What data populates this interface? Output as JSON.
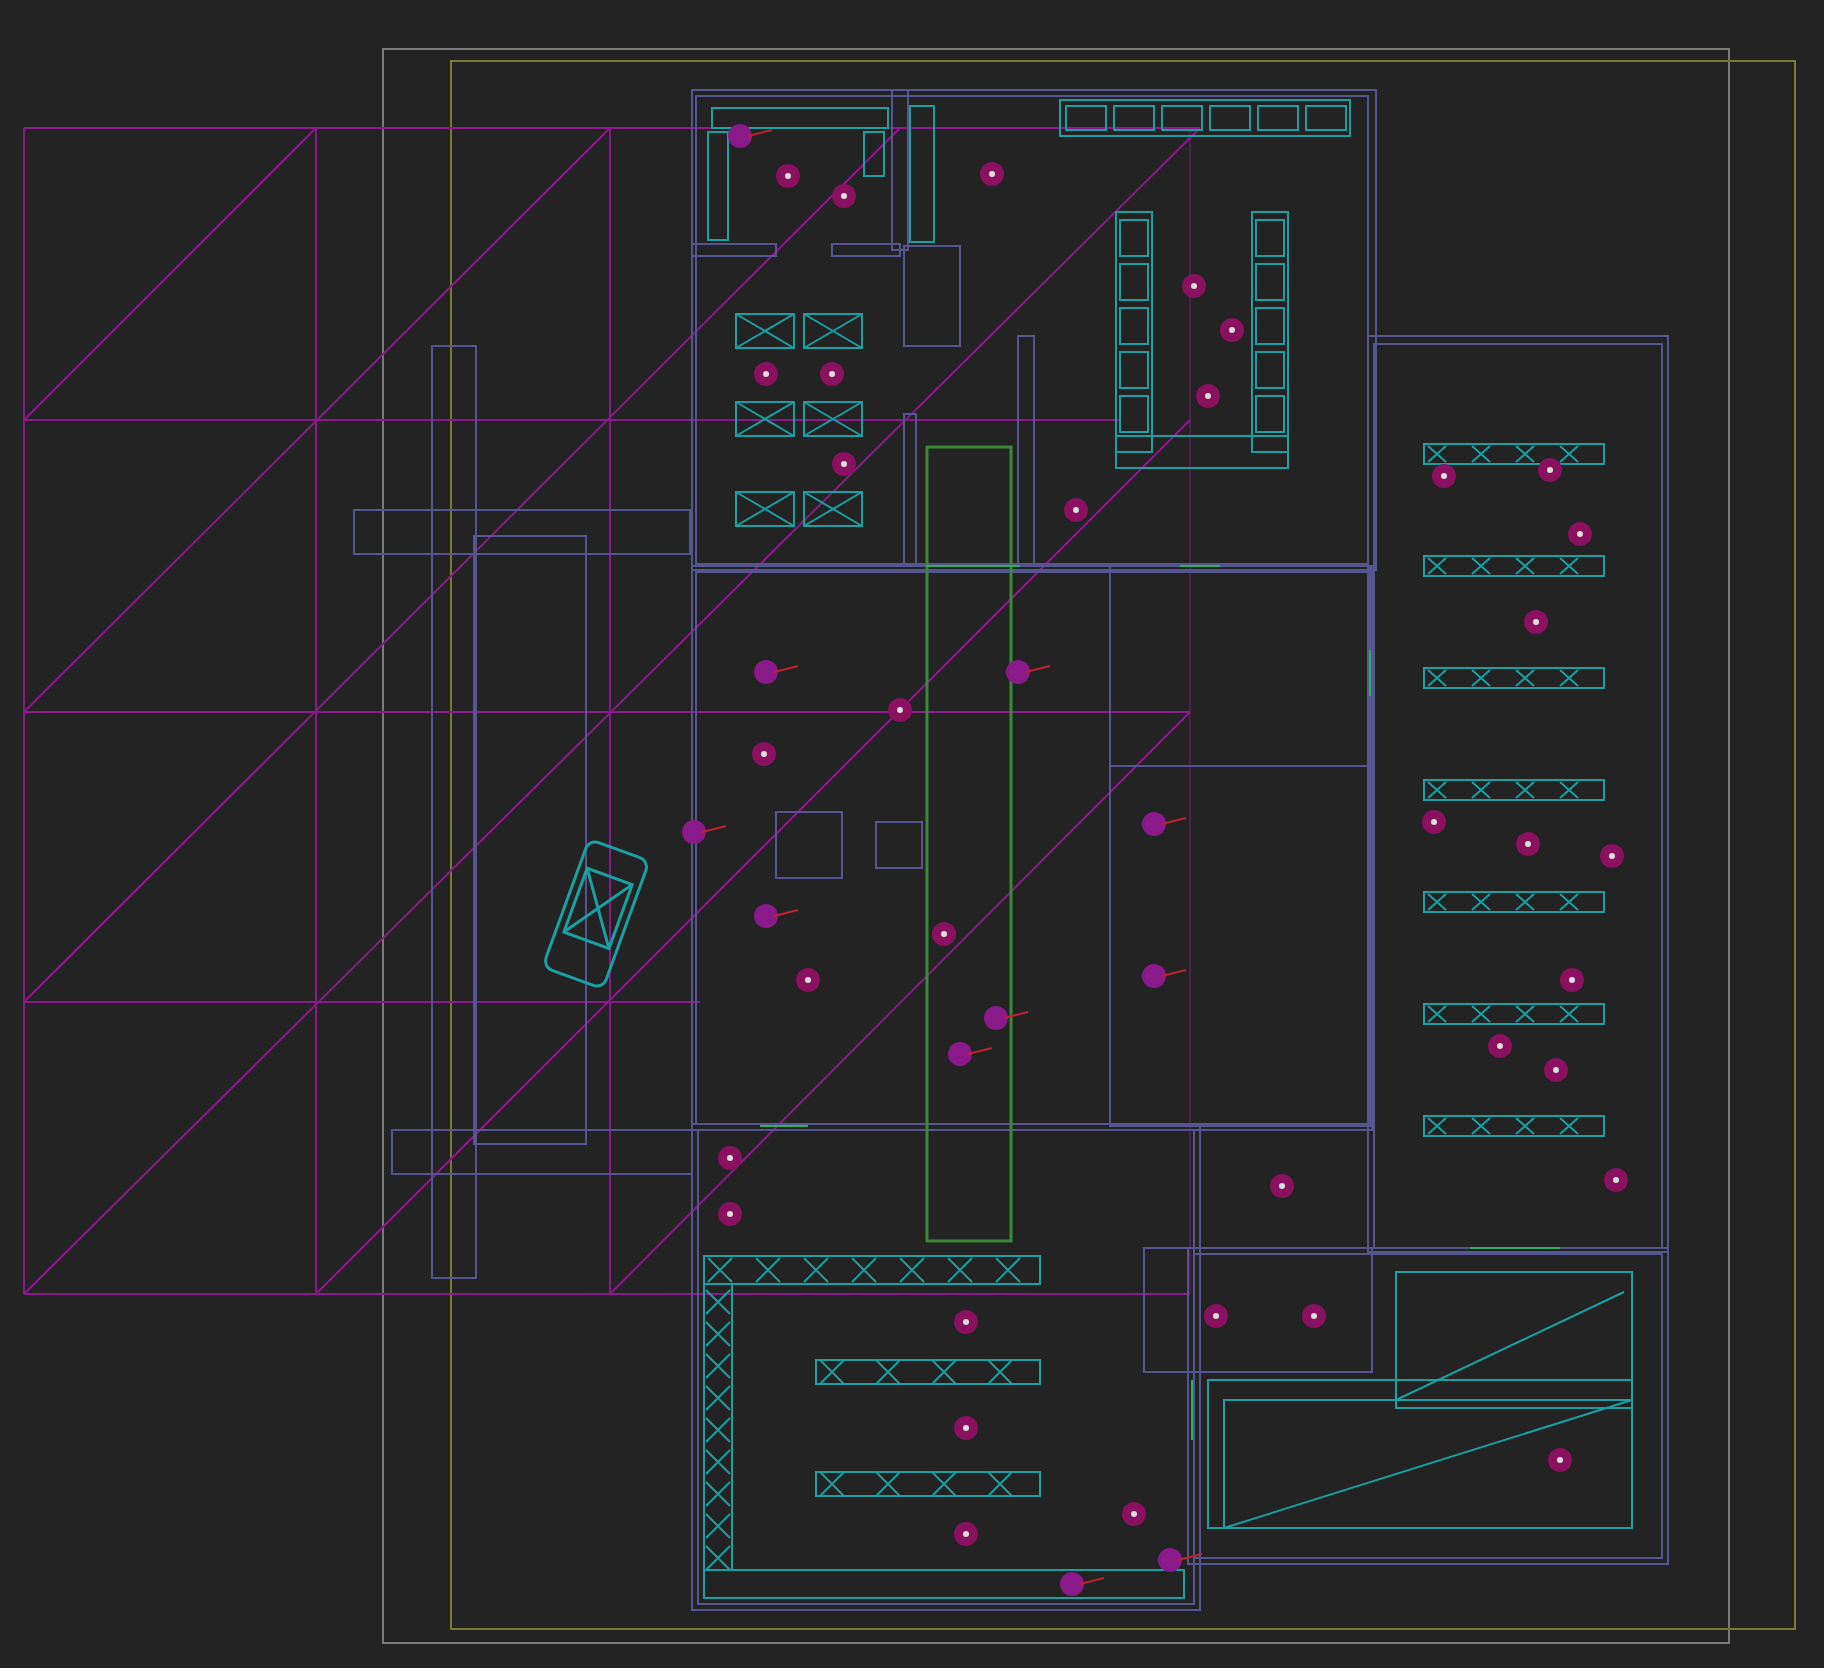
{
  "canvas": {
    "kind": "floor-plan"
  }
}
